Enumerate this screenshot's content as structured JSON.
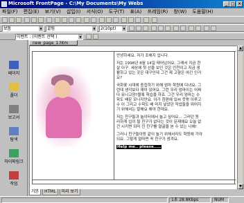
{
  "window": {
    "title": "Microsoft FrontPage - C:\\My Documents\\My Webs"
  },
  "menu": [
    "파일(F)",
    "편집(E)",
    "보기(V)",
    "삽입(I)",
    "서식(O)",
    "도구(T)",
    "표(A)",
    "프레임(R)",
    "창(W)",
    "도움말(H)"
  ],
  "toolbar": {
    "style_value": "보통",
    "font_value": "굴림",
    "size_value": "2(10pt)",
    "hyperlink_value": "이벤트 : (이벤트 선택 )"
  },
  "views": [
    {
      "label": "페이지",
      "icon": "page-icon"
    },
    {
      "label": "폴더",
      "icon": "folder-icon"
    },
    {
      "label": "보고서",
      "icon": "report-icon"
    },
    {
      "label": "탐색",
      "icon": "navigation-icon"
    },
    {
      "label": "하이퍼링크",
      "icon": "hyperlink-icon"
    },
    {
      "label": "작업",
      "icon": "tasks-icon"
    }
  ],
  "editor": {
    "tab_label": "new_page_1.htm",
    "greeting": "안녕하세요. 저가 조해지 입니다.",
    "para1": "저는 1998년 8월 14일 태어났어요. 그래서 지금 한살 이구. 세상에 첫 선을 보인 것은 인천이고 지금 생활하고 있는 곳은 대구인데 그건 제 고향은 여긴 인거요?",
    "para2": "국화꽃 시대에 중집하기 위해 엄마 학원에 다녀요. 그런데 생각보다 재미 있어요. 그런 우리 엄마이는 어쩌다 유니고양?블록 학습을 하죠. 그건 우리 엄마는 수학도 배운 모나지만요. 아가 흰편에 있씨 웃펑 이루고 수 이 그리고 수학도 배 마지 넣었던 작업들을 뛰어지기 위해서는 말해요 해야 한데요.",
    "para3": "저는 친구들과 놀이터에서 놀고 싶어요... 그러던 동리하게 입이 될 친구가 없다는 것이 문제예요 오늘 없건 시키면 되미 진 친구를 얼굴을 본 수 있는 나예!",
    "para4": "그러니 친구들이랑 같이 놀기 위해서라도 학원에 가야 되요. 그렇게 얼마면 꼭 친구가 생겨요.",
    "help_text": "Help me.. please....."
  },
  "bottom_tabs": [
    "기본",
    "HTML",
    "미리 보기"
  ],
  "status": {
    "time": "1초 28.8Kbps",
    "mode": "NUM"
  }
}
